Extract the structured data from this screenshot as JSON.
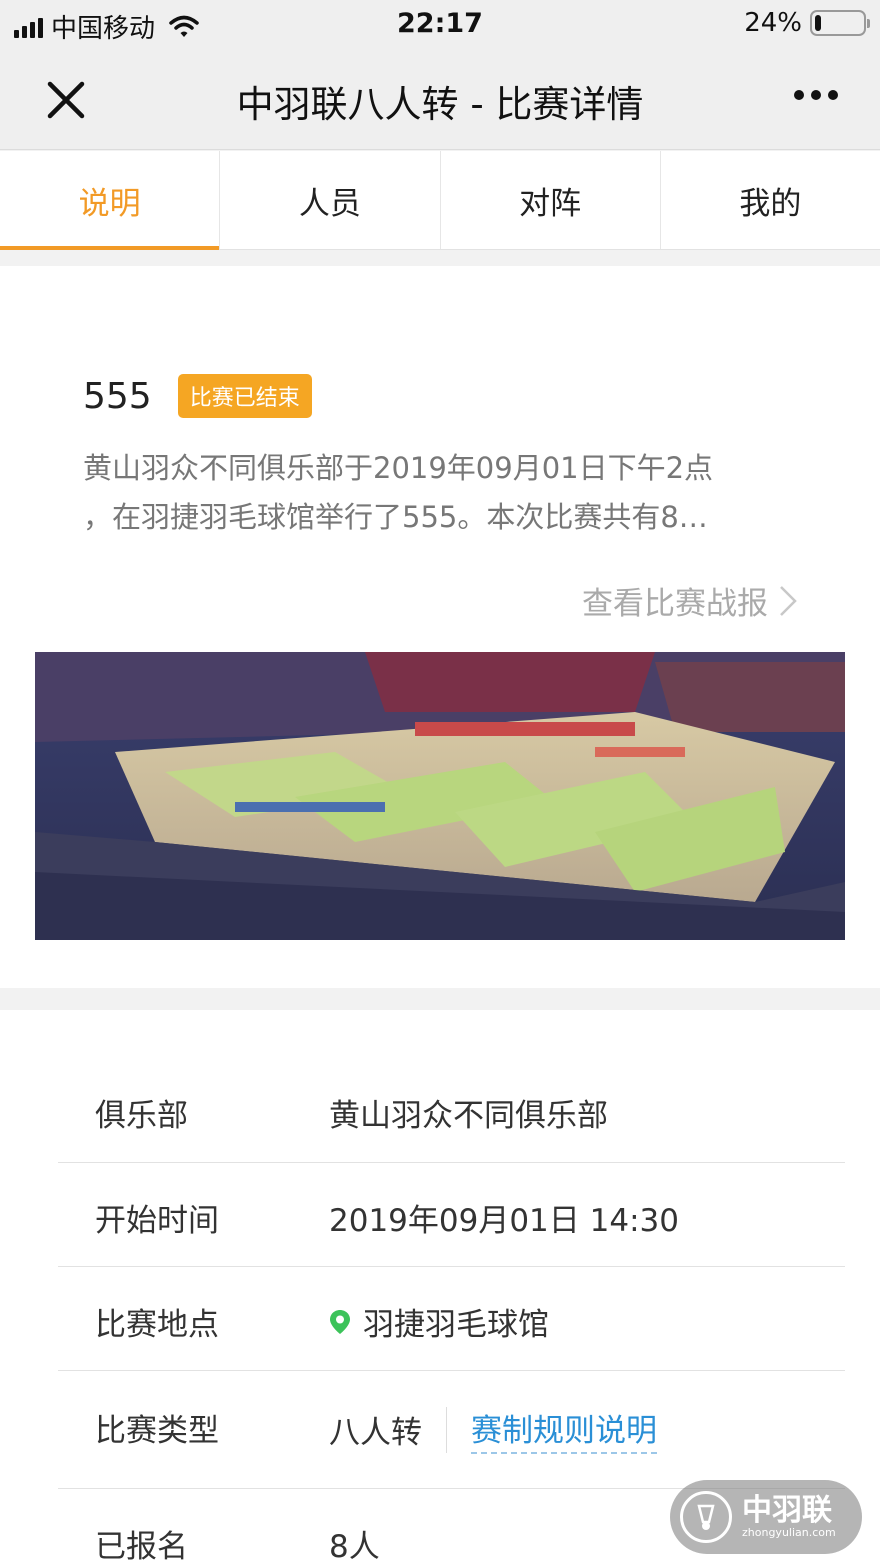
{
  "status_bar": {
    "carrier": "中国移动",
    "time": "22:17",
    "battery_percent": "24%",
    "battery_level": 0.24
  },
  "nav": {
    "title": "中羽联八人转 - 比赛详情",
    "close_icon": "close-icon",
    "more_icon": "more-icon"
  },
  "tabs": [
    {
      "label": "说明",
      "active": true
    },
    {
      "label": "人员",
      "active": false
    },
    {
      "label": "对阵",
      "active": false
    },
    {
      "label": "我的",
      "active": false
    }
  ],
  "match": {
    "name": "555",
    "status": "比赛已结束",
    "description_line1": "黄山羽众不同俱乐部于2019年09月01日下午2点",
    "description_line2": "，在羽捷羽毛球馆举行了555。本次比赛共有8…",
    "report_link": "查看比赛战报"
  },
  "info": {
    "club_label": "俱乐部",
    "club_value": "黄山羽众不同俱乐部",
    "start_label": "开始时间",
    "start_value": "2019年09月01日 14:30",
    "venue_label": "比赛地点",
    "venue_value": "羽捷羽毛球馆",
    "type_label": "比赛类型",
    "type_value": "八人转",
    "rules_link": "赛制规则说明",
    "signed_label": "已报名",
    "signed_value": "8人"
  },
  "watermark": {
    "text": "中羽联",
    "sub": "zhongyulian.com"
  },
  "colors": {
    "accent": "#f29a26",
    "badge": "#f5a623",
    "link": "#2a8fd6",
    "location_pin": "#3cc35a"
  }
}
